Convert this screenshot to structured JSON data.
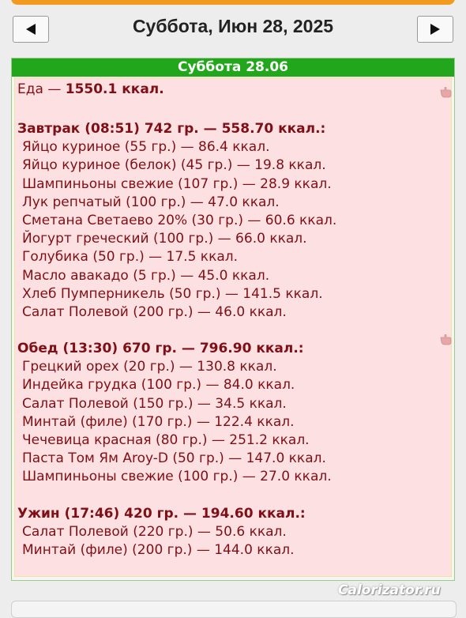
{
  "header": {
    "title": "Суббота, Июн 28, 2025",
    "prev_icon": "triangle-left-icon",
    "next_icon": "triangle-right-icon"
  },
  "day": {
    "bar_label": "Суббота 28.06",
    "total_prefix": "Еда —",
    "total_value": "1550.1 ккал."
  },
  "meals": [
    {
      "header": "Завтрак (08:51) 742 гр. — 558.70 ккал.:",
      "items": [
        "Яйцо куриное (55 гр.) — 86.4 ккал.",
        "Яйцо куриное (белок) (45 гр.) — 19.8 ккал.",
        "Шампиньоны свежие (107 гр.) — 28.9 ккал.",
        "Лук репчатый (100 гр.) — 47.0 ккал.",
        "Сметана Светаево 20% (30 гр.) — 60.6 ккал.",
        "Йогурт греческий (100 гр.) — 66.0 ккал.",
        "Голубика (50 гр.) — 17.5 ккал.",
        "Масло авакадо (5 гр.) — 45.0 ккал.",
        "Хлеб Пумперникель (50 гр.) — 141.5 ккал.",
        "Салат Полевой (200 гр.) — 46.0 ккал."
      ]
    },
    {
      "header": "Обед (13:30) 670 гр. — 796.90 ккал.:",
      "items": [
        "Грецкий орех (20 гр.) — 130.8 ккал.",
        "Индейка грудка (100 гр.) — 84.0 ккал.",
        "Салат Полевой (150 гр.) — 34.5 ккал.",
        "Минтай (филе) (170 гр.) — 122.4 ккал.",
        "Чечевица красная (80 гр.) — 251.2 ккал.",
        "Паста Том Ям Aroy-D (50 гр.) — 147.0 ккал.",
        "Шампиньоны свежие (100 гр.) — 27.0 ккал."
      ]
    },
    {
      "header": "Ужин (17:46) 420 гр. — 194.60 ккал.:",
      "items": [
        "Салат Полевой (220 гр.) — 50.6 ккал.",
        "Минтай (филе) (200 гр.) — 144.0 ккал."
      ]
    }
  ],
  "icons": {
    "edit": "pointing-hand-icon"
  },
  "watermark": "Calorizator.ru"
}
